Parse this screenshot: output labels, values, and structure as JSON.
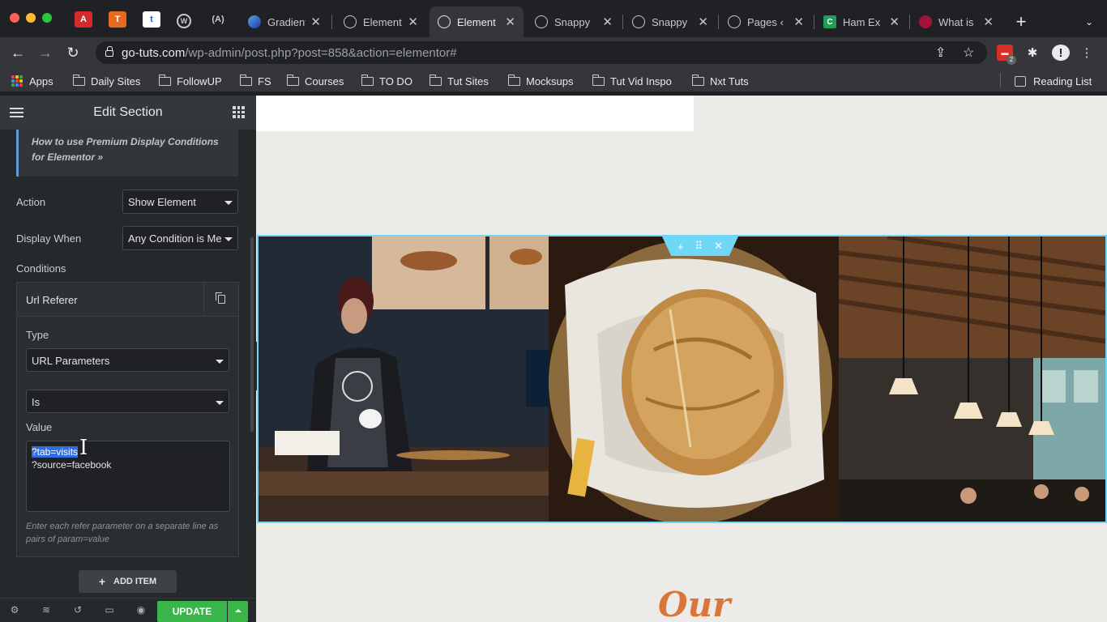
{
  "browser": {
    "tabs": [
      {
        "label": "Gradient"
      },
      {
        "label": "Element"
      },
      {
        "label": "Element"
      },
      {
        "label": "Snappy"
      },
      {
        "label": "Snappy"
      },
      {
        "label": "Pages ‹"
      },
      {
        "label": "Ham Ex"
      },
      {
        "label": "What is"
      }
    ],
    "url_domain": "go-tuts.com",
    "url_path": "/wp-admin/post.php?post=858&action=elementor#",
    "extension_badge": "2",
    "bookmarks": [
      "Apps",
      "Daily Sites",
      "FollowUP",
      "FS",
      "Courses",
      "TO DO",
      "Tut Sites",
      "Mocksups",
      "Tut Vid Inspo",
      "Nxt Tuts"
    ],
    "reading_list": "Reading List"
  },
  "panel": {
    "title": "Edit Section",
    "notice_text": "How to use Premium Display Conditions for Elementor »",
    "action_label": "Action",
    "action_value": "Show Element",
    "display_when_label": "Display When",
    "display_when_value": "Any Condition is Me",
    "conditions_label": "Conditions",
    "repeater_title": "Url Referer",
    "type_label": "Type",
    "type_value": "URL Parameters",
    "operator_value": "Is",
    "value_label": "Value",
    "value_line1": "?tab=visits",
    "value_line2": "?source=facebook",
    "hint": "Enter each refer parameter on a separate line as pairs of param=value",
    "add_item": "ADD ITEM",
    "update": "UPDATE"
  },
  "canvas": {
    "heading": "Our",
    "handle_icons": [
      "plus-icon",
      "drag-icon",
      "close-icon"
    ]
  },
  "colors": {
    "accent": "#71d7f7",
    "update_green": "#39b54a",
    "heading_orange": "#d8763b"
  }
}
